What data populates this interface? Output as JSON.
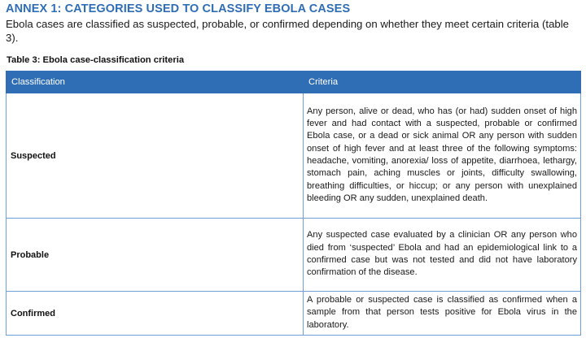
{
  "annex_title": "ANNEX 1: CATEGORIES USED TO CLASSIFY EBOLA CASES",
  "intro_text": "Ebola cases are classified as suspected, probable, or confirmed depending on whether they meet certain criteria (table 3).",
  "table_caption": "Table 3: Ebola case-classification criteria",
  "colors": {
    "heading": "#2f6eb5",
    "header_fill": "#2f6eb5",
    "header_text": "#ffffff",
    "border": "#6f9fd4"
  },
  "table": {
    "headers": [
      "Classification",
      "Criteria"
    ],
    "rows": [
      {
        "classification": "Suspected",
        "criteria": "Any person, alive or dead, who has (or had) sudden onset of high fever and had contact with a suspected, probable or confirmed Ebola case, or a dead or sick animal OR any person with sudden onset of high fever and at least three of the following symptoms: headache, vomiting, anorexia/ loss of appetite, diarrhoea, lethargy, stomach pain, aching muscles or joints, difficulty swallowing, breathing difficulties, or hiccup; or any person with unexplained bleeding OR any sudden, unexplained death."
      },
      {
        "classification": "Probable",
        "criteria": "Any suspected case evaluated by a clinician OR any person who died from ‘suspected’ Ebola and had an epidemiological link to a confirmed case but was not tested and did not have laboratory confirmation of the disease."
      },
      {
        "classification": "Confirmed",
        "criteria": "A probable or suspected case is classified as confirmed when a sample from that person tests positive for Ebola virus in the laboratory."
      }
    ]
  }
}
